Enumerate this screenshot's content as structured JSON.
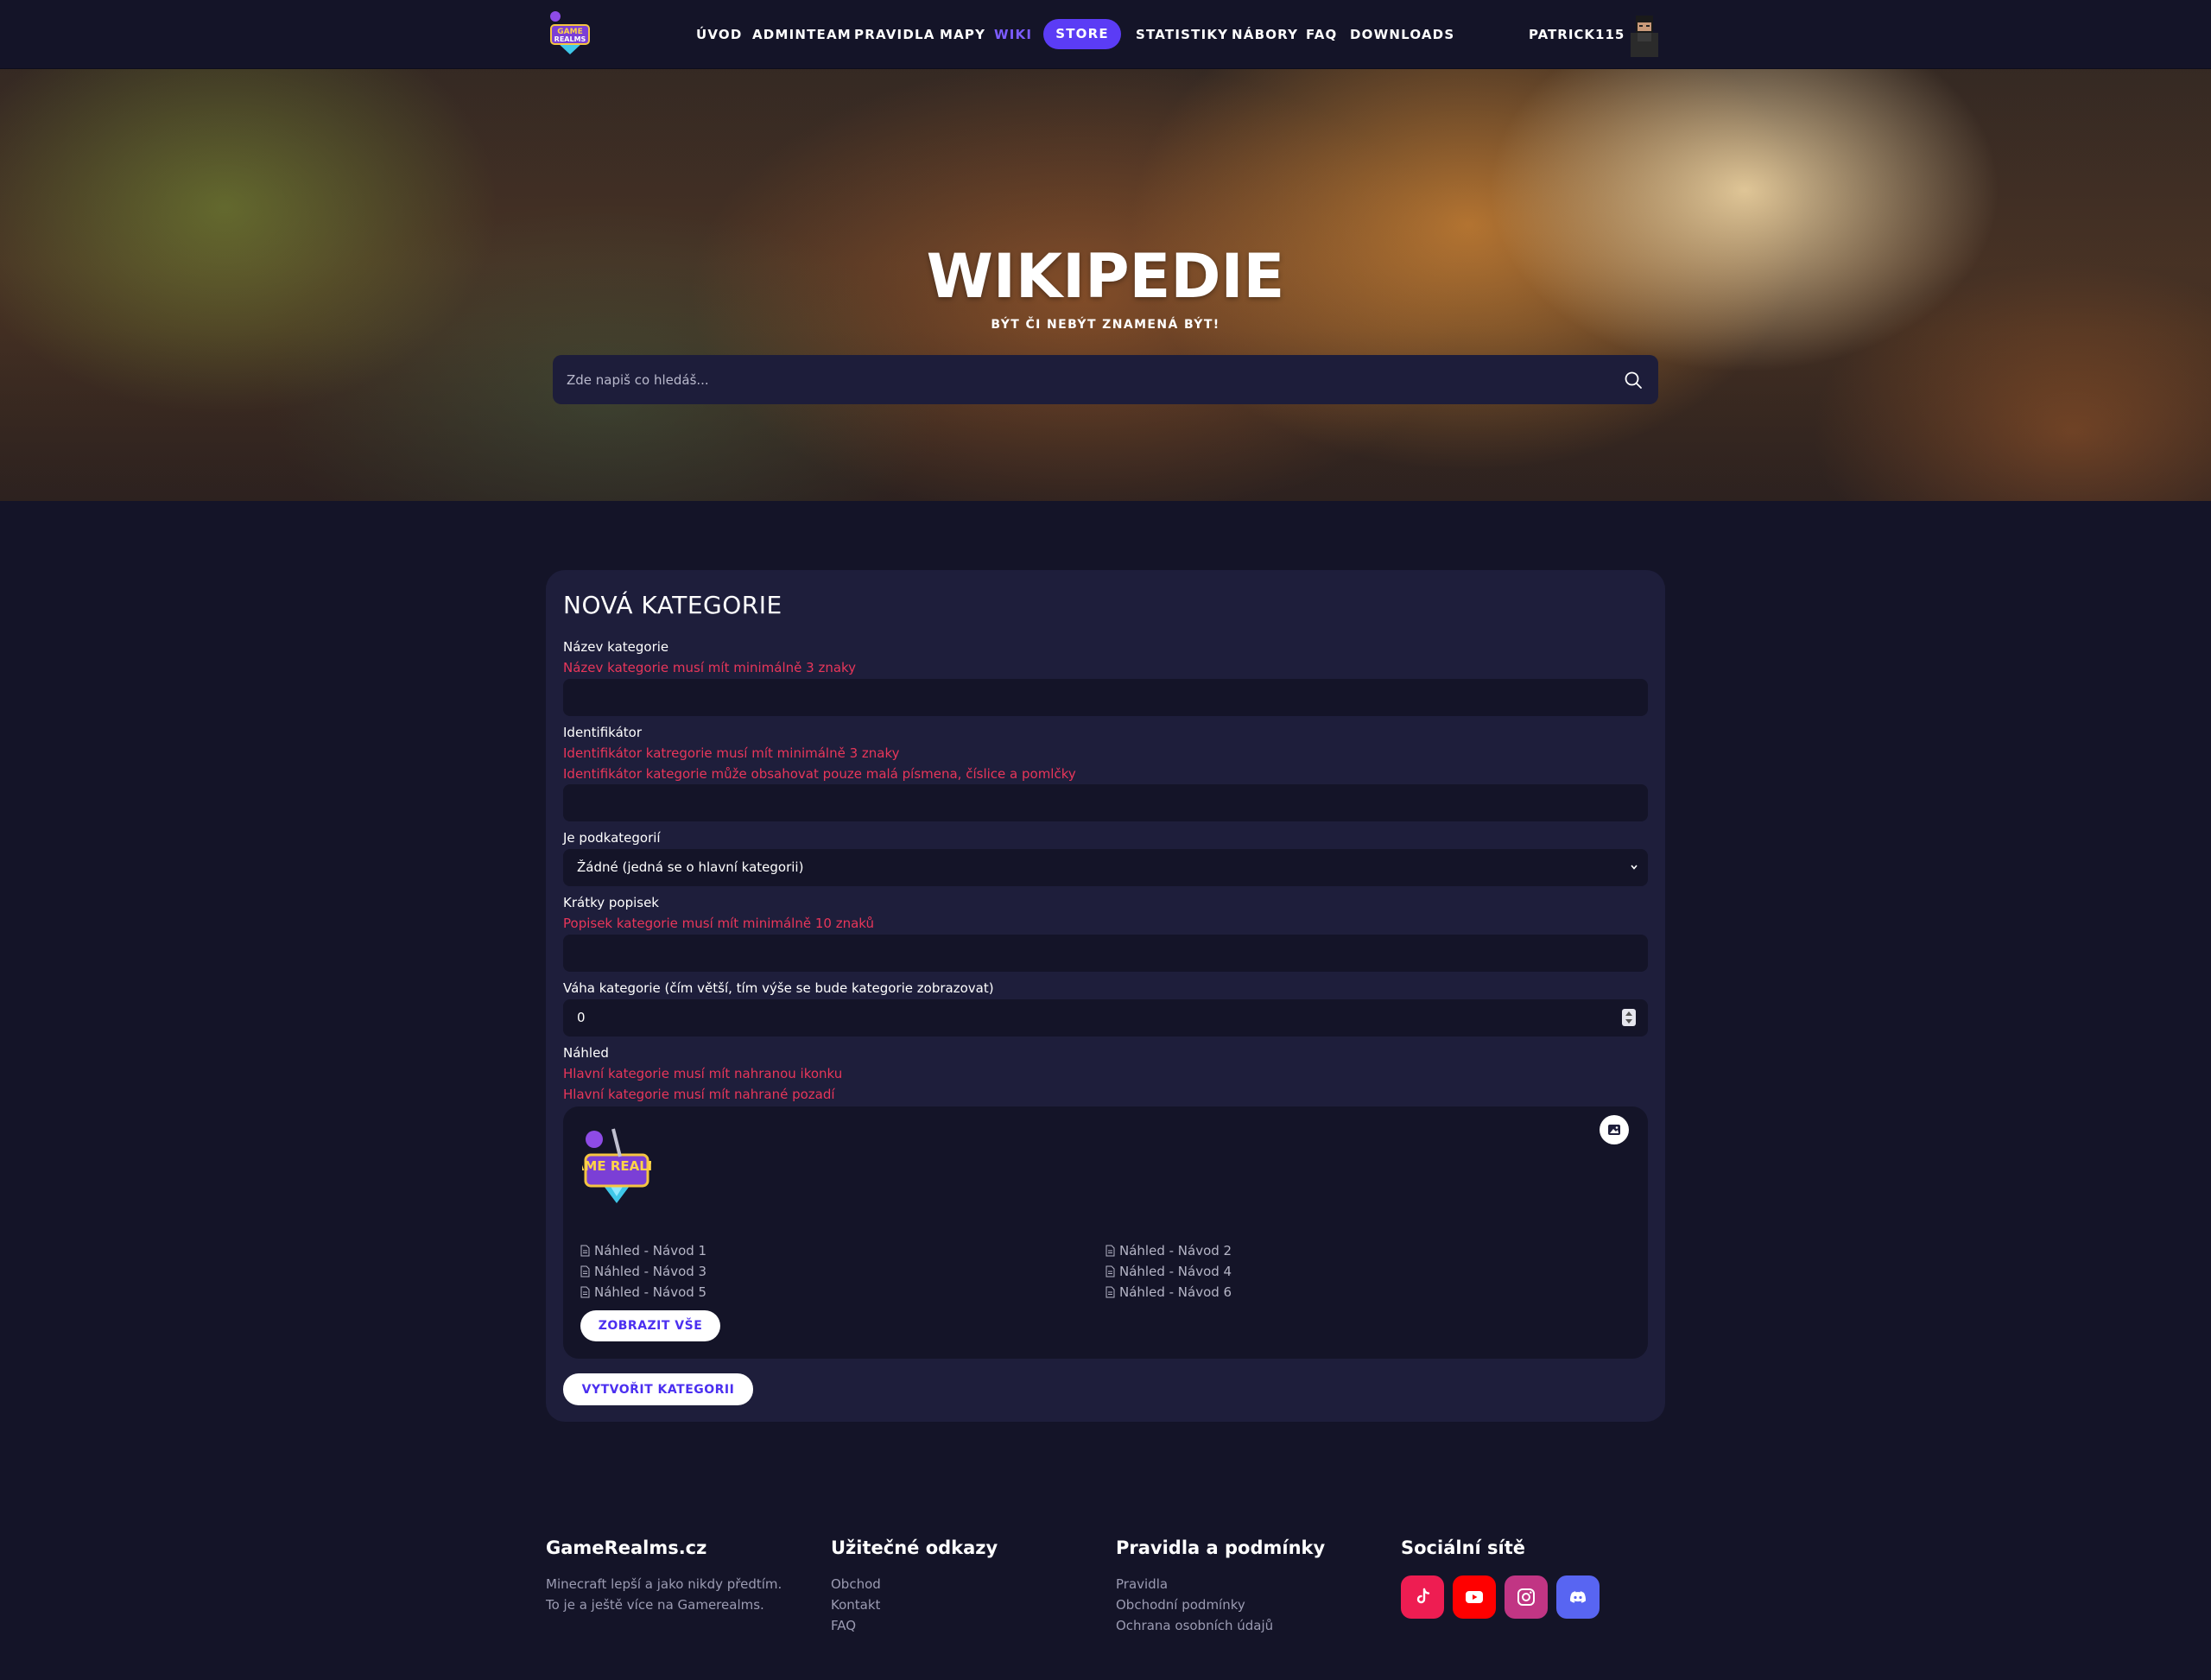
{
  "nav": {
    "links": [
      "ÚVOD",
      "ADMINTEAM",
      "PRAVIDLA",
      "MAPY",
      "WIKI"
    ],
    "store": "STORE",
    "links_right": [
      "STATISTIKY",
      "NÁBORY",
      "FAQ",
      "DOWNLOADS"
    ],
    "active": "WIKI",
    "username": "PATRICK115"
  },
  "hero": {
    "title": "WIKIPEDIE",
    "subtitle": "BÝT ČI NEBÝT ZNAMENÁ BÝT!",
    "search_placeholder": "Zde napiš co hledáš..."
  },
  "form": {
    "title": "NOVÁ KATEGORIE",
    "name": {
      "label": "Název kategorie",
      "errors": [
        "Název kategorie musí mít minimálně 3 znaky"
      ],
      "value": ""
    },
    "identifier": {
      "label": "Identifikátor",
      "errors": [
        "Identifikátor katregorie musí mít minimálně 3 znaky",
        "Identifikátor kategorie může obsahovat pouze malá písmena, číslice a pomlčky"
      ],
      "value": ""
    },
    "parent": {
      "label": "Je podkategorií",
      "selected": "Žádné (jedná se o hlavní kategorii)"
    },
    "description": {
      "label": "Krátky popisek",
      "errors": [
        "Popisek kategorie musí mít minimálně 10 znaků"
      ],
      "value": ""
    },
    "weight": {
      "label": "Váha kategorie (čím větší, tím výše se bude kategorie zobrazovat)",
      "value": "0"
    },
    "preview": {
      "label": "Náhled",
      "errors": [
        "Hlavní kategorie musí mít nahranou ikonku",
        "Hlavní kategorie musí mít nahrané pozadí"
      ],
      "logo_text": "GAME REALMS",
      "items": [
        "Náhled - Návod 1",
        "Náhled - Návod 2",
        "Náhled - Návod 3",
        "Náhled - Návod 4",
        "Náhled - Návod 5",
        "Náhled - Návod 6"
      ],
      "show_all": "ZOBRAZIT VŠE"
    },
    "submit": "VYTVOŘIT KATEGORII"
  },
  "footer": {
    "brand": {
      "title": "GameRealms.cz",
      "text_lines": [
        "Minecraft lepší a jako nikdy předtím.",
        "To je a ještě více na Gamerealms."
      ]
    },
    "useful": {
      "title": "Užitečné odkazy",
      "links": [
        "Obchod",
        "Kontakt",
        "FAQ"
      ]
    },
    "rules": {
      "title": "Pravidla a podmínky",
      "links": [
        "Pravidla",
        "Obchodní podmínky",
        "Ochrana osobních údajů"
      ]
    },
    "social": {
      "title": "Sociální sítě",
      "icons": [
        "tiktok-icon",
        "youtube-icon",
        "instagram-icon",
        "discord-icon"
      ]
    }
  },
  "colors": {
    "background": "#141428",
    "card": "#1e1e3b",
    "accent": "#5b3cf5",
    "error": "#e8365a",
    "tiktok": "#ee1d52",
    "youtube": "#ff0000",
    "instagram": "#c13584",
    "discord": "#5865f2"
  }
}
